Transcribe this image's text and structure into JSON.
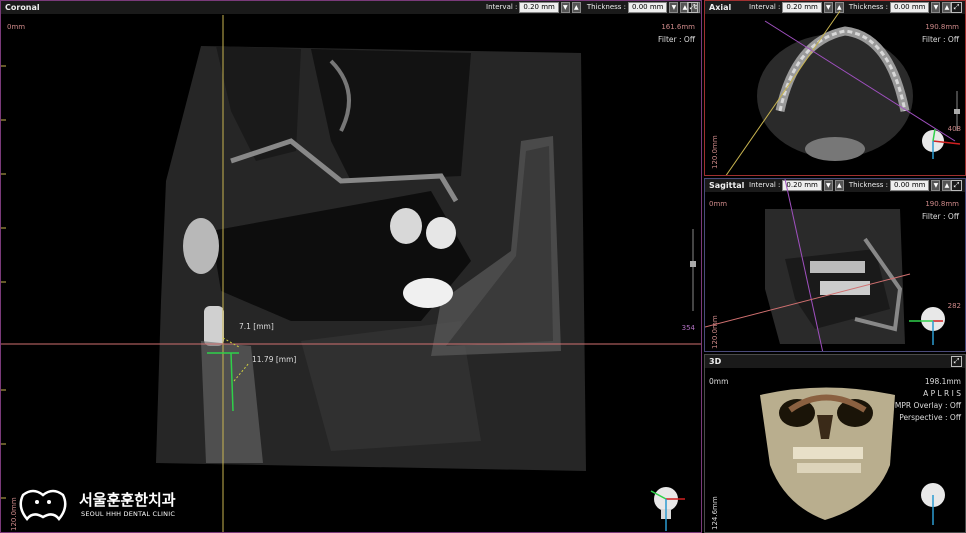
{
  "coronal": {
    "title": "Coronal",
    "interval_label": "Interval :",
    "interval_value": "0.20 mm",
    "thickness_label": "Thickness :",
    "thickness_value": "0.00 mm",
    "origin": "0mm",
    "size": "161.6mm",
    "filter": "Filter :  Off",
    "slice": "354",
    "bottom": "120.0mm",
    "measure1": "7.1 [mm]",
    "measure2": "11.79 [mm]"
  },
  "axial": {
    "title": "Axial",
    "interval_label": "Interval :",
    "interval_value": "0.20 mm",
    "thickness_label": "Thickness :",
    "thickness_value": "0.00 mm",
    "size": "190.8mm",
    "filter": "Filter :  Off",
    "slice": "408",
    "bottom": "120.0mm"
  },
  "sagittal": {
    "title": "Sagittal",
    "interval_label": "Interval :",
    "interval_value": "0.20 mm",
    "thickness_label": "Thickness :",
    "thickness_value": "0.00 mm",
    "origin": "0mm",
    "size": "190.8mm",
    "filter": "Filter :  Off",
    "slice": "282",
    "bottom": "120.0mm"
  },
  "view3d": {
    "title": "3D",
    "origin": "0mm",
    "size": "198.1mm",
    "orient": "A P L R I S",
    "mpr_overlay": "MPR Overlay : Off",
    "perspective": "Perspective : Off",
    "bottom": "124.6mm"
  },
  "logo": {
    "name": "서울훈훈한치과",
    "sub": "SEOUL HHH DENTAL CLINIC"
  },
  "colors": {
    "border": "#7a3a7a",
    "crosshair_v": "#c8b450",
    "crosshair_h": "#d07070",
    "measure": "#2fd04a"
  }
}
